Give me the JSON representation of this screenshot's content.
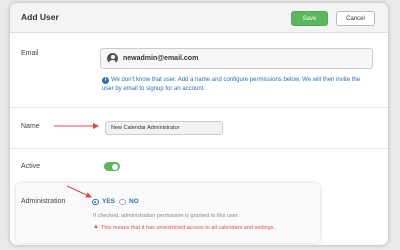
{
  "header": {
    "title": "Add User",
    "save_label": "Save",
    "cancel_label": "Cancel"
  },
  "email": {
    "label": "Email",
    "value": "newadmin@email.com",
    "info_line1": "We don't know that user. Add a name and configure permissions below. We will then invite the",
    "info_line2": "user by email to signup for an account."
  },
  "name": {
    "label": "Name",
    "value": "New Calendar Administrator"
  },
  "active": {
    "label": "Active",
    "enabled": true
  },
  "administration": {
    "label": "Administration",
    "options": [
      {
        "label": "YES",
        "selected": true
      },
      {
        "label": "NO",
        "selected": false
      }
    ],
    "help": "If checked, administration permission is granted to this user.",
    "warning": "This means that it has unrestricted access to all calendars and settings."
  },
  "icons": {
    "user": "user-avatar-icon",
    "info": "info-circle-icon",
    "warning": "warning-triangle-icon"
  },
  "colors": {
    "accent": "#2f6eb5",
    "save": "#5cb85c",
    "warning": "#d9534f",
    "annotation_arrow": "#d94a4a"
  }
}
